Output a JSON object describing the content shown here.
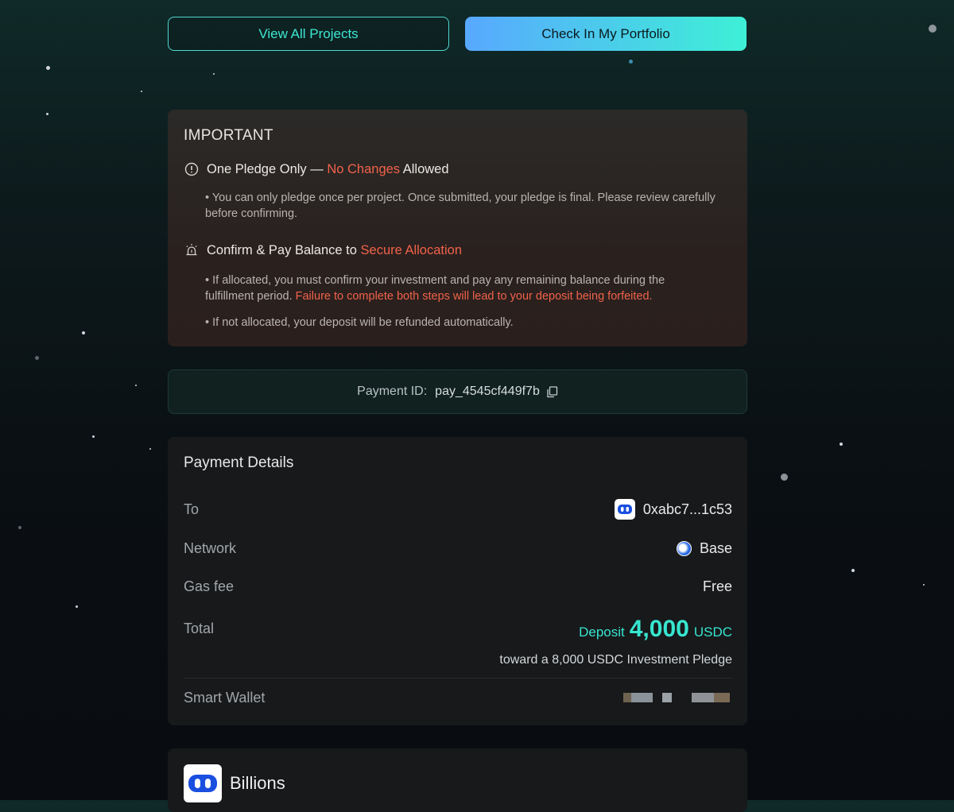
{
  "buttons": {
    "view_all": "View All Projects",
    "portfolio": "Check In My Portfolio"
  },
  "important": {
    "title": "IMPORTANT",
    "item1": {
      "head_a": "One Pledge Only — ",
      "head_red": "No Changes",
      "head_b": " Allowed",
      "text": "• You can only pledge once per project. Once submitted, your pledge is final. Please review carefully before confirming."
    },
    "item2": {
      "head_a": "Confirm & Pay Balance to ",
      "head_red": "Secure Allocation",
      "text_a": "• If allocated, you must confirm your investment and pay any remaining balance during the fulfillment period. ",
      "text_red": "Failure to complete both steps will lead to your deposit being forfeited.",
      "text2": "• If not allocated, your deposit will be refunded automatically."
    }
  },
  "payment_id": {
    "label": "Payment ID:",
    "value": "pay_4545cf449f7b"
  },
  "details": {
    "title": "Payment Details",
    "to_label": "To",
    "to_value": "0xabc7...1c53",
    "network_label": "Network",
    "network_value": "Base",
    "gas_label": "Gas fee",
    "gas_value": "Free",
    "total_label": "Total",
    "deposit_word": "Deposit",
    "deposit_amount": "4,000",
    "deposit_unit": "USDC",
    "toward": "toward a 8,000 USDC Investment Pledge",
    "wallet_label": "Smart Wallet"
  },
  "project": {
    "name": "Billions"
  },
  "colors": {
    "accent_teal": "#37e6cf",
    "warning_red": "#f0624a"
  }
}
